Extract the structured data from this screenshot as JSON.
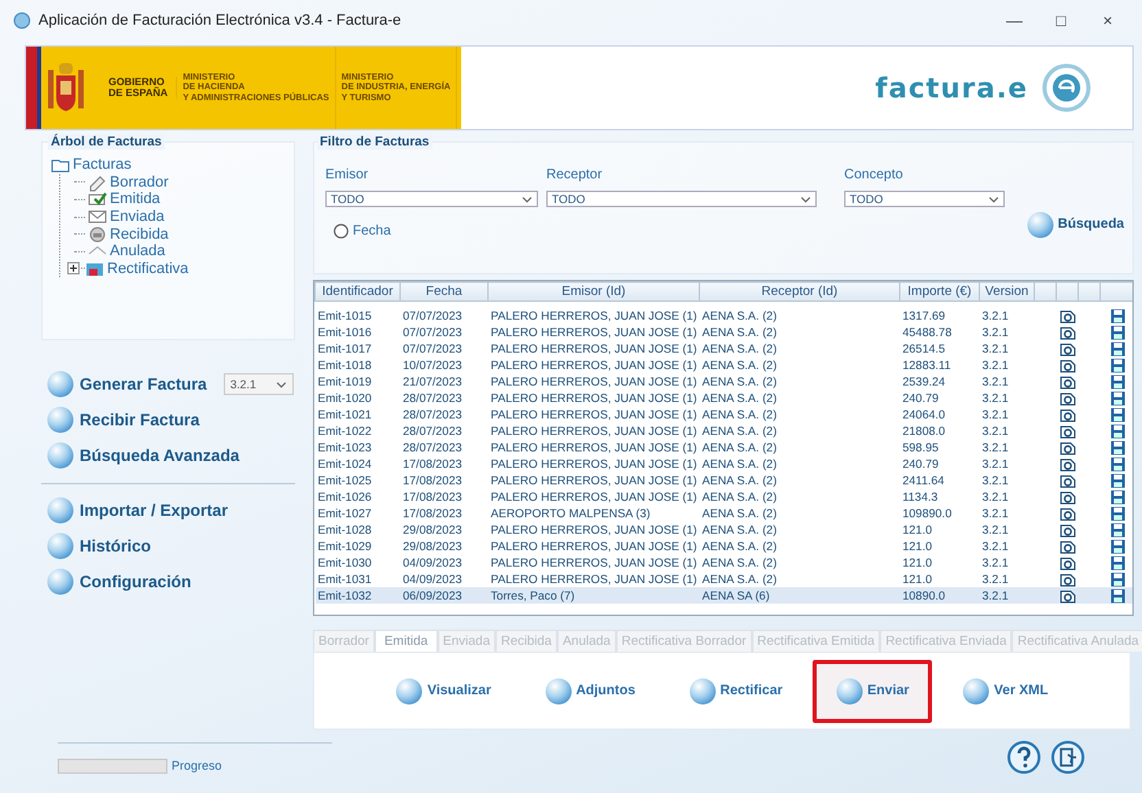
{
  "window": {
    "title": "Aplicación de Facturación Electrónica v3.4 - Factura-e",
    "controls": [
      "—",
      "□",
      "×"
    ]
  },
  "banner": {
    "government": [
      "GOBIERNO",
      "DE ESPAÑA"
    ],
    "ministries": [
      [
        "MINISTERIO",
        "DE HACIENDA",
        "Y ADMINISTRACIONES PÚBLICAS"
      ],
      [
        "MINISTERIO",
        "DE INDUSTRIA, ENERGÍA",
        "Y TURISMO"
      ]
    ],
    "logo": "factura.e"
  },
  "tree": {
    "title": "Árbol de Facturas",
    "root": {
      "label": "Facturas",
      "kind": "folder",
      "children": [
        {
          "label": "Borrador",
          "kind": "draft"
        },
        {
          "label": "Emitida",
          "kind": "issued"
        },
        {
          "label": "Enviada",
          "kind": "sent"
        },
        {
          "label": "Recibida",
          "kind": "received"
        },
        {
          "label": "Anulada",
          "kind": "cancelled"
        },
        {
          "label": "Rectificativa",
          "kind": "corrective",
          "expanded": false
        }
      ]
    }
  },
  "action_groups": [
    [
      {
        "label": "Generar Factura",
        "version": "3.2.1"
      },
      {
        "label": "Recibir Factura"
      },
      {
        "label": "Búsqueda Avanzada"
      }
    ],
    [
      {
        "label": "Importar / Exportar"
      },
      {
        "label": "Histórico"
      },
      {
        "label": "Configuración"
      }
    ]
  ],
  "filter": {
    "title": "Filtro de Facturas",
    "fields": [
      {
        "label": "Emisor",
        "value": "TODO"
      },
      {
        "label": "Receptor",
        "value": "TODO"
      },
      {
        "label": "Concepto",
        "value": "TODO"
      }
    ],
    "date_option": {
      "label": "Fecha",
      "checked": false
    },
    "search_button": "Búsqueda"
  },
  "table": {
    "columns": [
      "Identificador",
      "Fecha",
      "Emisor (Id)",
      "Receptor (Id)",
      "Importe (€)",
      "Version"
    ],
    "rows": [
      {
        "cells": [
          "Emit-1015",
          "07/07/2023",
          "PALERO HERREROS, JUAN JOSE (1)",
          "AENA S.A. (2)",
          "1317.69",
          "3.2.1"
        ],
        "selected": false
      },
      {
        "cells": [
          "Emit-1016",
          "07/07/2023",
          "PALERO HERREROS, JUAN JOSE (1)",
          "AENA S.A. (2)",
          "45488.78",
          "3.2.1"
        ],
        "selected": false
      },
      {
        "cells": [
          "Emit-1017",
          "07/07/2023",
          "PALERO HERREROS, JUAN JOSE (1)",
          "AENA S.A. (2)",
          "26514.5",
          "3.2.1"
        ],
        "selected": false
      },
      {
        "cells": [
          "Emit-1018",
          "10/07/2023",
          "PALERO HERREROS, JUAN JOSE (1)",
          "AENA S.A. (2)",
          "12883.11",
          "3.2.1"
        ],
        "selected": false
      },
      {
        "cells": [
          "Emit-1019",
          "21/07/2023",
          "PALERO HERREROS, JUAN JOSE (1)",
          "AENA S.A. (2)",
          "2539.24",
          "3.2.1"
        ],
        "selected": false
      },
      {
        "cells": [
          "Emit-1020",
          "28/07/2023",
          "PALERO HERREROS, JUAN JOSE (1)",
          "AENA S.A. (2)",
          "240.79",
          "3.2.1"
        ],
        "selected": false
      },
      {
        "cells": [
          "Emit-1021",
          "28/07/2023",
          "PALERO HERREROS, JUAN JOSE (1)",
          "AENA S.A. (2)",
          "24064.0",
          "3.2.1"
        ],
        "selected": false
      },
      {
        "cells": [
          "Emit-1022",
          "28/07/2023",
          "PALERO HERREROS, JUAN JOSE (1)",
          "AENA S.A. (2)",
          "21808.0",
          "3.2.1"
        ],
        "selected": false
      },
      {
        "cells": [
          "Emit-1023",
          "28/07/2023",
          "PALERO HERREROS, JUAN JOSE (1)",
          "AENA S.A. (2)",
          "598.95",
          "3.2.1"
        ],
        "selected": false
      },
      {
        "cells": [
          "Emit-1024",
          "17/08/2023",
          "PALERO HERREROS, JUAN JOSE (1)",
          "AENA S.A. (2)",
          "240.79",
          "3.2.1"
        ],
        "selected": false
      },
      {
        "cells": [
          "Emit-1025",
          "17/08/2023",
          "PALERO HERREROS, JUAN JOSE (1)",
          "AENA S.A. (2)",
          "2411.64",
          "3.2.1"
        ],
        "selected": false
      },
      {
        "cells": [
          "Emit-1026",
          "17/08/2023",
          "PALERO HERREROS, JUAN JOSE (1)",
          "AENA S.A. (2)",
          "1134.3",
          "3.2.1"
        ],
        "selected": false
      },
      {
        "cells": [
          "Emit-1027",
          "17/08/2023",
          "AEROPORTO MALPENSA (3)",
          "AENA S.A. (2)",
          "109890.0",
          "3.2.1"
        ],
        "selected": false
      },
      {
        "cells": [
          "Emit-1028",
          "29/08/2023",
          "PALERO HERREROS, JUAN JOSE (1)",
          "AENA S.A. (2)",
          "121.0",
          "3.2.1"
        ],
        "selected": false
      },
      {
        "cells": [
          "Emit-1029",
          "29/08/2023",
          "PALERO HERREROS, JUAN JOSE (1)",
          "AENA S.A. (2)",
          "121.0",
          "3.2.1"
        ],
        "selected": false
      },
      {
        "cells": [
          "Emit-1030",
          "04/09/2023",
          "PALERO HERREROS, JUAN JOSE (1)",
          "AENA S.A. (2)",
          "121.0",
          "3.2.1"
        ],
        "selected": false
      },
      {
        "cells": [
          "Emit-1031",
          "04/09/2023",
          "PALERO HERREROS, JUAN JOSE (1)",
          "AENA S.A. (2)",
          "121.0",
          "3.2.1"
        ],
        "selected": false
      },
      {
        "cells": [
          "Emit-1032",
          "06/09/2023",
          "Torres, Paco (7)",
          "AENA SA (6)",
          "10890.0",
          "3.2.1"
        ],
        "selected": true
      }
    ]
  },
  "tabs": [
    {
      "label": "Borrador",
      "selected": false
    },
    {
      "label": "Emitida",
      "selected": true
    },
    {
      "label": "Enviada",
      "selected": false
    },
    {
      "label": "Recibida",
      "selected": false
    },
    {
      "label": "Anulada",
      "selected": false
    },
    {
      "label": "Rectificativa Borrador",
      "selected": false
    },
    {
      "label": "Rectificativa Emitida",
      "selected": false
    },
    {
      "label": "Rectificativa Enviada",
      "selected": false
    },
    {
      "label": "Rectificativa Anulada",
      "selected": false
    }
  ],
  "actions": [
    {
      "label": "Visualizar",
      "highlighted": false
    },
    {
      "label": "Adjuntos",
      "highlighted": false
    },
    {
      "label": "Rectificar",
      "highlighted": false
    },
    {
      "label": "Enviar",
      "highlighted": true
    },
    {
      "label": "Ver XML",
      "highlighted": false
    }
  ],
  "status": {
    "label": "Progreso",
    "level": 0
  }
}
